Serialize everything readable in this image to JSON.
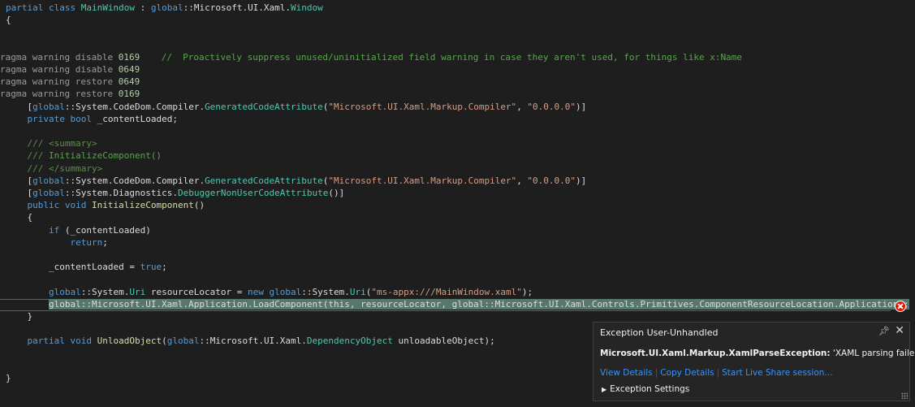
{
  "colors": {
    "background": "#1e1e1e",
    "keyword": "#569cd6",
    "type": "#4ec9b0",
    "method": "#dcdcaa",
    "string": "#d69d85",
    "number": "#b5cea8",
    "comment": "#57a64a",
    "highlight": "#56776a",
    "error": "#e51400",
    "link": "#3794ff"
  },
  "editor": {
    "lines": [
      [
        {
          "t": "partial ",
          "c": "kw"
        },
        {
          "t": "class ",
          "c": "kw"
        },
        {
          "t": "MainWindow",
          "c": "ty"
        },
        {
          "t": " : ",
          "c": "id"
        },
        {
          "t": "global",
          "c": "kw"
        },
        {
          "t": "::Microsoft.UI.Xaml.",
          "c": "id"
        },
        {
          "t": "Window",
          "c": "ty"
        }
      ],
      [
        {
          "t": "{",
          "c": "id"
        }
      ],
      [],
      [],
      [
        {
          "t": "ragma warning disable ",
          "c": "pp"
        },
        {
          "t": "0169",
          "c": "num"
        },
        {
          "t": "    //  Proactively suppress unused/uninitialized field warning in case they aren't used, for things like x:Name",
          "c": "cm"
        }
      ],
      [
        {
          "t": "ragma warning disable ",
          "c": "pp"
        },
        {
          "t": "0649",
          "c": "num"
        }
      ],
      [
        {
          "t": "ragma warning restore ",
          "c": "pp"
        },
        {
          "t": "0649",
          "c": "num"
        }
      ],
      [
        {
          "t": "ragma warning restore ",
          "c": "pp"
        },
        {
          "t": "0169",
          "c": "num"
        }
      ],
      [
        {
          "t": "    [",
          "c": "id"
        },
        {
          "t": "global",
          "c": "kw"
        },
        {
          "t": "::System.CodeDom.Compiler.",
          "c": "id"
        },
        {
          "t": "GeneratedCodeAttribute",
          "c": "ty"
        },
        {
          "t": "(",
          "c": "id"
        },
        {
          "t": "\"Microsoft.UI.Xaml.Markup.Compiler\"",
          "c": "str"
        },
        {
          "t": ",",
          "c": "id"
        },
        {
          "t": " \"0.0.0.0\"",
          "c": "str"
        },
        {
          "t": ")]",
          "c": "id"
        }
      ],
      [
        {
          "t": "    private ",
          "c": "kw"
        },
        {
          "t": "bool ",
          "c": "kw"
        },
        {
          "t": "_contentLoaded;",
          "c": "id"
        }
      ],
      [],
      [
        {
          "t": "    /// <summary>",
          "c": "xml"
        }
      ],
      [
        {
          "t": "    /// ",
          "c": "xml"
        },
        {
          "t": "InitializeComponent()",
          "c": "cm"
        }
      ],
      [
        {
          "t": "    /// </summary>",
          "c": "xml"
        }
      ],
      [
        {
          "t": "    [",
          "c": "id"
        },
        {
          "t": "global",
          "c": "kw"
        },
        {
          "t": "::System.CodeDom.Compiler.",
          "c": "id"
        },
        {
          "t": "GeneratedCodeAttribute",
          "c": "ty"
        },
        {
          "t": "(",
          "c": "id"
        },
        {
          "t": "\"Microsoft.UI.Xaml.Markup.Compiler\"",
          "c": "str"
        },
        {
          "t": ",",
          "c": "id"
        },
        {
          "t": " \"0.0.0.0\"",
          "c": "str"
        },
        {
          "t": ")]",
          "c": "id"
        }
      ],
      [
        {
          "t": "    [",
          "c": "id"
        },
        {
          "t": "global",
          "c": "kw"
        },
        {
          "t": "::System.Diagnostics.",
          "c": "id"
        },
        {
          "t": "DebuggerNonUserCodeAttribute",
          "c": "ty"
        },
        {
          "t": "()]",
          "c": "id"
        }
      ],
      [
        {
          "t": "    public ",
          "c": "kw"
        },
        {
          "t": "void ",
          "c": "kw"
        },
        {
          "t": "InitializeComponent",
          "c": "fn"
        },
        {
          "t": "()",
          "c": "id"
        }
      ],
      [
        {
          "t": "    {",
          "c": "id"
        }
      ],
      [
        {
          "t": "        if ",
          "c": "kw"
        },
        {
          "t": "(_contentLoaded)",
          "c": "id"
        }
      ],
      [
        {
          "t": "            return",
          "c": "kw"
        },
        {
          "t": ";",
          "c": "id"
        }
      ],
      [],
      [
        {
          "t": "        _contentLoaded = ",
          "c": "id"
        },
        {
          "t": "true",
          "c": "kw"
        },
        {
          "t": ";",
          "c": "id"
        }
      ],
      [],
      [
        {
          "t": "        global",
          "c": "kw"
        },
        {
          "t": "::System.",
          "c": "id"
        },
        {
          "t": "Uri ",
          "c": "ty"
        },
        {
          "t": "resourceLocator = ",
          "c": "id"
        },
        {
          "t": "new ",
          "c": "kw"
        },
        {
          "t": "global",
          "c": "kw"
        },
        {
          "t": "::System.",
          "c": "id"
        },
        {
          "t": "Uri",
          "c": "ty"
        },
        {
          "t": "(",
          "c": "id"
        },
        {
          "t": "\"ms-appx:///MainWindow.xaml\"",
          "c": "str"
        },
        {
          "t": ");",
          "c": "id"
        }
      ],
      [
        {
          "t": "        ",
          "c": "id"
        },
        {
          "t": "global::Microsoft.UI.Xaml.Application.LoadComponent(this, resourceLocator, global::Microsoft.UI.Xaml.Controls.Primitives.ComponentResourceLocation.Application);",
          "c": "hl"
        }
      ],
      [
        {
          "t": "    }",
          "c": "id"
        }
      ],
      [],
      [
        {
          "t": "    partial ",
          "c": "kw"
        },
        {
          "t": "void ",
          "c": "kw"
        },
        {
          "t": "UnloadObject",
          "c": "fn"
        },
        {
          "t": "(",
          "c": "id"
        },
        {
          "t": "global",
          "c": "kw"
        },
        {
          "t": "::Microsoft.UI.Xaml.",
          "c": "id"
        },
        {
          "t": "DependencyObject ",
          "c": "ty"
        },
        {
          "t": "unloadableObject);",
          "c": "id"
        }
      ],
      [],
      [],
      [
        {
          "t": "}",
          "c": "id"
        }
      ]
    ]
  },
  "popup": {
    "title": "Exception User-Unhandled",
    "pin_icon": "pin-icon",
    "close_icon": "close-icon",
    "exception_type": "Microsoft.UI.Xaml.Markup.XamlParseException:",
    "exception_message": " 'XAML parsing failed.'",
    "links": [
      "View Details",
      "Copy Details",
      "Start Live Share session..."
    ],
    "settings_label": "Exception Settings"
  }
}
